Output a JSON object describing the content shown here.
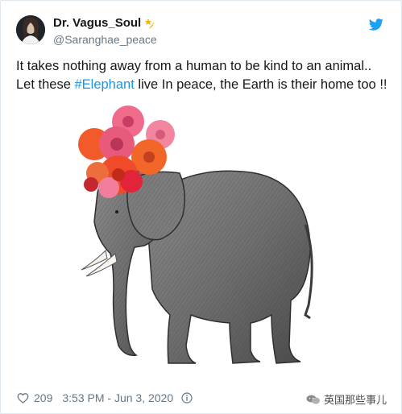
{
  "author": {
    "display_name": "Dr. Vagus_Soul",
    "handle": "@Saranghae_peace"
  },
  "tweet": {
    "line1": "It takes nothing away from a human to be kind to an animal..",
    "line2_pre": "Let these ",
    "hashtag": "#Elephant",
    "line2_post": " live In peace, the Earth is their home too !!"
  },
  "footer": {
    "likes": "209",
    "timestamp": "3:53 PM - Jun 3, 2020"
  },
  "watermark": {
    "text": "英国那些事儿"
  },
  "colors": {
    "twitter_blue": "#1da1f2",
    "hashtag_blue": "#1b95e0",
    "secondary_text": "#657786"
  },
  "icons": {
    "brand": "twitter-bird-icon",
    "like": "heart-icon",
    "info": "info-icon",
    "badge": "star-emoji-icon",
    "watermark": "wechat-icon"
  }
}
